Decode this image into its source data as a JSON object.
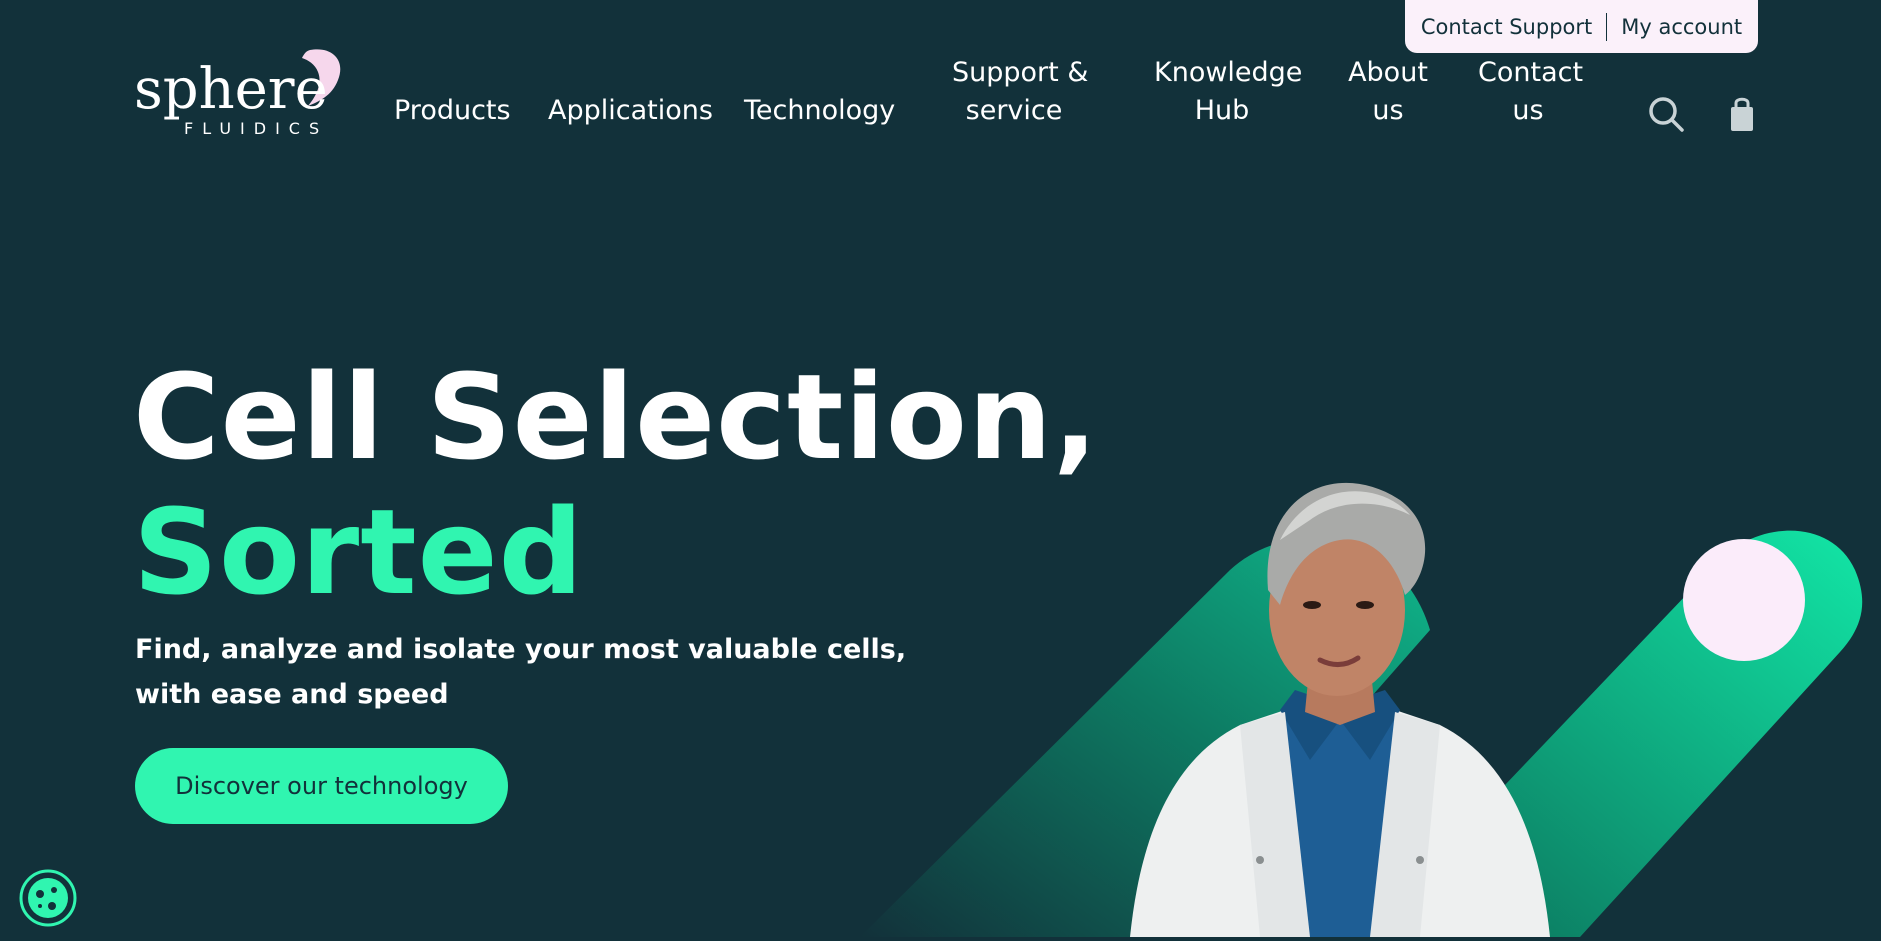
{
  "utility_bar": {
    "contact_support": "Contact Support",
    "my_account": "My account"
  },
  "brand": {
    "name": "sphere",
    "tagline": "FLUIDICS"
  },
  "nav": {
    "items": [
      {
        "label": "Products"
      },
      {
        "label": "Applications"
      },
      {
        "label": "Technology"
      },
      {
        "line1": "Support &",
        "line2": "service"
      },
      {
        "line1": "Knowledge",
        "line2": "Hub"
      },
      {
        "line1": "About",
        "line2": "us"
      },
      {
        "line1": "Contact",
        "line2": "us"
      }
    ],
    "icons": [
      "search-icon",
      "shopping-bag-icon"
    ]
  },
  "hero": {
    "title_line1": "Cell Selection,",
    "title_line2": "Sorted",
    "subtitle": "Find, analyze and isolate your most valuable cells, with ease and speed",
    "cta_label": "Discover our technology"
  },
  "widgets": {
    "cookie_icon": "cookie-icon"
  },
  "colors": {
    "background": "#12313a",
    "accent": "#30f5b0",
    "utility_bar": "#fbf1fa"
  }
}
